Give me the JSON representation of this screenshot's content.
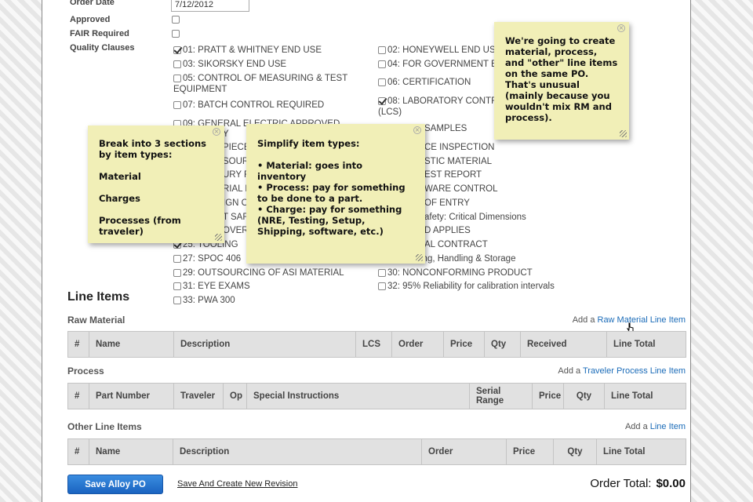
{
  "form": {
    "order_date_label": "Order Date",
    "order_date_value": "7/12/2012",
    "approved_label": "Approved",
    "fair_label": "FAIR Required",
    "quality_label": "Quality Clauses"
  },
  "quality_clauses": [
    {
      "label": "01: PRATT & WHITNEY END USE",
      "checked": true
    },
    {
      "label": "02: HONEYWELL END USE",
      "checked": false
    },
    {
      "label": "03: SIKORSKY END USE",
      "checked": false
    },
    {
      "label": "04: FOR GOVERNMENT END",
      "checked": false
    },
    {
      "label": "05: CONTROL OF MEASURING & TEST",
      "label2": "EQUIPMENT",
      "checked": false
    },
    {
      "label": "06: CERTIFICATION",
      "checked": false
    },
    {
      "label": "07: BATCH CONTROL REQUIRED",
      "checked": false
    },
    {
      "label": "08: LABORATORY CONTRO",
      "label2": "(LCS)",
      "checked": true
    },
    {
      "label": "09: GENERAL ELECTRIC APPROVED",
      "checked": false
    },
    {
      "label": "SAMPLES"
    },
    {
      "label": "Y"
    },
    {
      "label": "CE INSPECTION"
    },
    {
      "label": "PIECE"
    },
    {
      "label": "STIC MATERIAL"
    },
    {
      "label": "SOURC"
    },
    {
      "label": "EST REPORT"
    },
    {
      "label": "URY FI"
    },
    {
      "label": "WARE CONTROL"
    },
    {
      "label": "RIAL H"
    },
    {
      "label": "OF ENTRY"
    },
    {
      "label": "IGN OB"
    },
    {
      "label": "afety: Critical Dimensions"
    },
    {
      "label": "T SAFE"
    },
    {
      "label": "D APPLIES"
    },
    {
      "label": "OVER"
    },
    {
      "label": "AL CONTRACT"
    },
    {
      "label": "25: TOOLING",
      "checked": true
    },
    {
      "label": "ing, Handling & Storage"
    },
    {
      "label": "27: SPOC 406",
      "checked": false
    },
    {
      "label": "29: OUTSOURCING OF ASI MATERIAL",
      "checked": false
    },
    {
      "label": "30: NONCONFORMING PRODUCT",
      "checked": false
    },
    {
      "label": "31: EYE EXAMS",
      "checked": false
    },
    {
      "label": "32: 95% Reliability for calibration intervals",
      "checked": false
    },
    {
      "label": "33: PWA 300",
      "checked": false
    }
  ],
  "line_items": {
    "title": "Line Items",
    "raw": {
      "title": "Raw Material",
      "add_prefix": "Add a",
      "add_link": "Raw Material Line Item",
      "columns": [
        "#",
        "Name",
        "Description",
        "LCS",
        "Order",
        "Price",
        "Qty",
        "Received",
        "Line Total"
      ]
    },
    "process": {
      "title": "Process",
      "add_prefix": "Add a",
      "add_link": "Traveler Process Line Item",
      "columns": [
        "#",
        "Part Number",
        "Traveler",
        "Op",
        "Special Instructions",
        "Serial Range",
        "Price",
        "Qty",
        "Line Total"
      ]
    },
    "other": {
      "title": "Other Line Items",
      "add_prefix": "Add a",
      "add_link": "Line Item",
      "columns": [
        "#",
        "Name",
        "Description",
        "Order",
        "Price",
        "Qty",
        "Line Total"
      ]
    }
  },
  "footer": {
    "save_label": "Save Alloy PO",
    "revision_label": "Save And Create New Revision",
    "total_label": "Order Total:",
    "total_value": "$0.00"
  },
  "notes": {
    "sections": {
      "lines": [
        "Break into 3 sections by item types:",
        "Material",
        "Charges",
        "Processes (from traveler)"
      ]
    },
    "simplify": {
      "title": "Simplify item types:",
      "items": [
        "• Material: goes into inventory",
        "• Process: pay for something to be done to a part.",
        "• Charge: pay for something (NRE, Testing, Setup, Shipping, software, etc.)"
      ]
    },
    "unusual": {
      "text": "We're going to create material, process, and \"other\" line items on the same PO. That's unusual (mainly because you wouldn't mix RM and process)."
    }
  },
  "icons": {
    "close": "close-icon",
    "resize": "resize-grip-icon",
    "cursor": "cursor-icon"
  }
}
